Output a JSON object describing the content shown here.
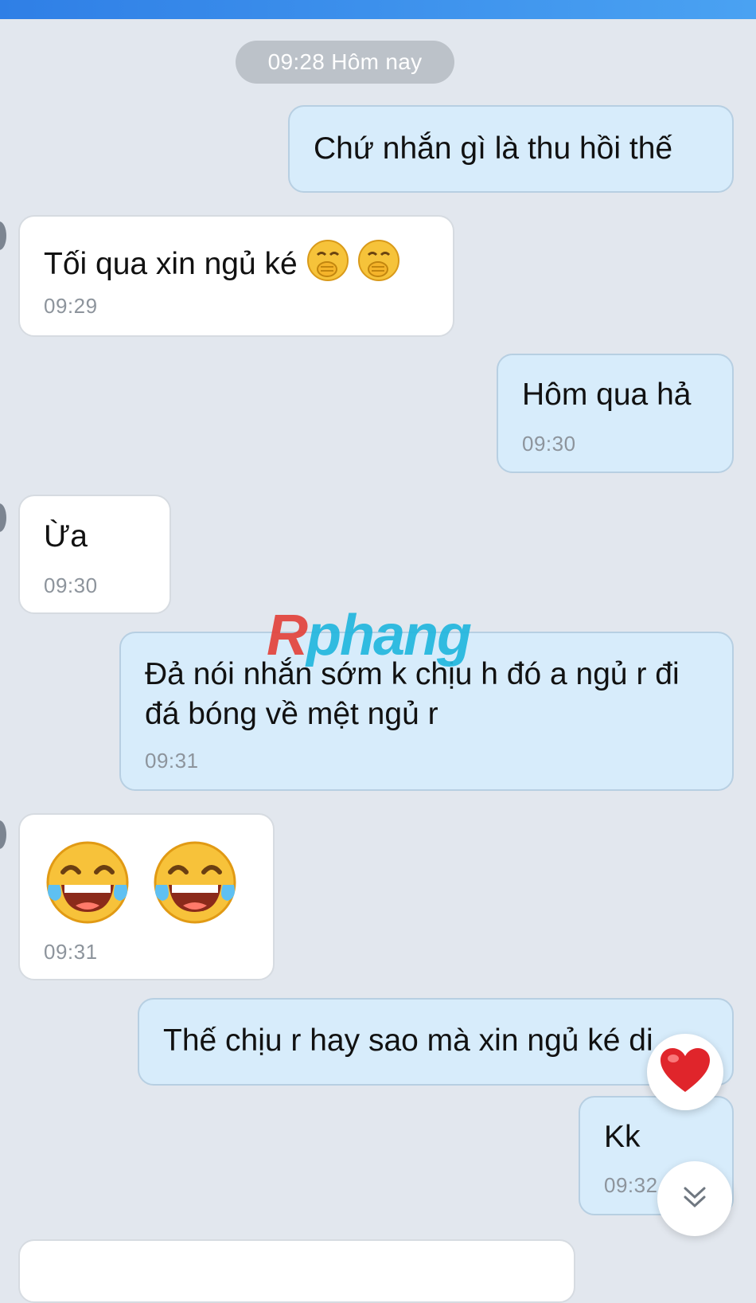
{
  "header": {
    "date_divider": "09:28 Hôm nay"
  },
  "messages": [
    {
      "dir": "out",
      "text": "Chứ nhắn gì là thu hồi thế",
      "time": ""
    },
    {
      "dir": "in",
      "text": "Tối qua xin ngủ ké",
      "emoji": [
        "hand-over-mouth-emoji",
        "hand-over-mouth-emoji"
      ],
      "time": "09:29"
    },
    {
      "dir": "out",
      "text": "Hôm qua hả",
      "time": "09:30"
    },
    {
      "dir": "in",
      "text": "Ừa",
      "time": "09:30"
    },
    {
      "dir": "out",
      "text": "Đả nói nhắn sớm k chịu h đó a ngủ r đi đá bóng về mệt ngủ r",
      "time": "09:31"
    },
    {
      "dir": "in",
      "text": "",
      "emoji": [
        "tears-of-joy-emoji",
        "tears-of-joy-emoji"
      ],
      "time": "09:31"
    },
    {
      "dir": "out",
      "text": "Thế chịu r hay sao mà xin ngủ ké di",
      "time": ""
    },
    {
      "dir": "out",
      "text": "Kk",
      "time": "09:32"
    }
  ],
  "watermark": {
    "prefix": "R",
    "rest": "phang"
  },
  "controls": {
    "reaction_icon": "heart-icon",
    "scroll_icon": "double-chevron-down-icon"
  },
  "colors": {
    "incoming_bubble": "#ffffff",
    "outgoing_bubble": "#d7ecfb",
    "background": "#e2e7ee",
    "heart": "#e0252b"
  }
}
